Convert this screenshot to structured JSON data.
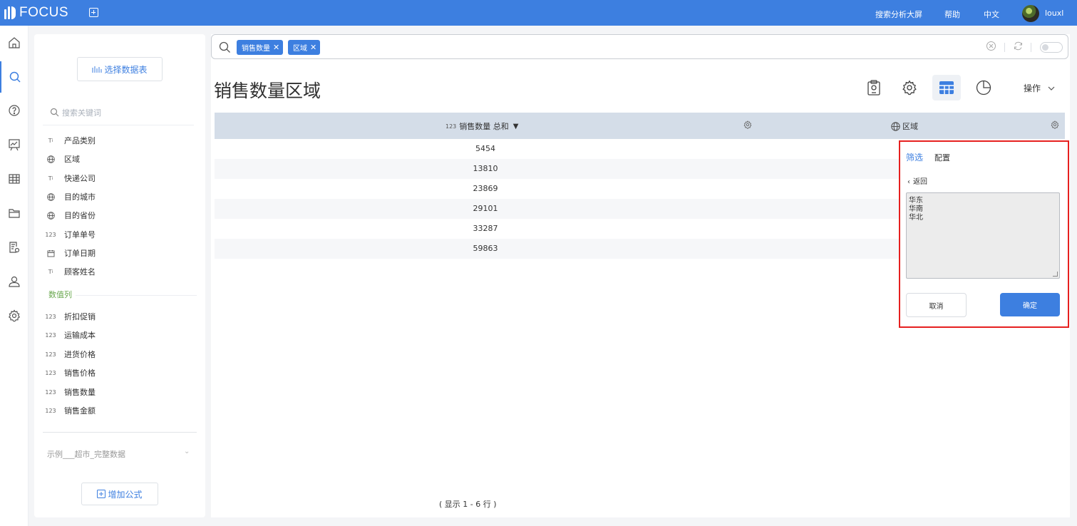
{
  "topbar": {
    "logo_text": "FOCUS",
    "links": {
      "dashboard": "搜索分析大屏",
      "help": "帮助",
      "language": "中文"
    },
    "username": "louxl"
  },
  "colors": {
    "brand": "#3d7fe0",
    "highlight_border": "#e6201f",
    "numeric_label": "#6aa84f"
  },
  "leftnav": [
    "home-icon",
    "search-icon",
    "help-icon",
    "chart-board-icon",
    "table-icon",
    "folder-icon",
    "report-settings-icon",
    "user-icon",
    "settings-icon"
  ],
  "sidebar": {
    "select_table_label": "选择数据表",
    "search_placeholder": "搜索关键词",
    "attribute_columns": [
      {
        "type": "text",
        "label": "产品类别"
      },
      {
        "type": "geo",
        "label": "区域"
      },
      {
        "type": "text",
        "label": "快递公司"
      },
      {
        "type": "geo",
        "label": "目的城市"
      },
      {
        "type": "geo",
        "label": "目的省份"
      },
      {
        "type": "number",
        "label": "订单单号"
      },
      {
        "type": "date",
        "label": "订单日期"
      },
      {
        "type": "text",
        "label": "顾客姓名"
      }
    ],
    "numeric_section_label": "数值列",
    "numeric_columns": [
      {
        "type": "number",
        "label": "折扣促销"
      },
      {
        "type": "number",
        "label": "运输成本"
      },
      {
        "type": "number",
        "label": "进货价格"
      },
      {
        "type": "number",
        "label": "销售价格"
      },
      {
        "type": "number",
        "label": "销售数量"
      },
      {
        "type": "number",
        "label": "销售金额"
      }
    ],
    "number_tag": "123",
    "example_source": "示例___超市_完整数据",
    "add_formula_label": "增加公式"
  },
  "search": {
    "tokens": [
      "销售数量",
      "区域"
    ]
  },
  "page_title": "销售数量区域",
  "toolbar": {
    "ops_label": "操作"
  },
  "table": {
    "columns": [
      {
        "tag": "123",
        "label": "销售数量 总和"
      },
      {
        "label": "区域"
      }
    ],
    "rows": [
      "5454",
      "13810",
      "23869",
      "29101",
      "33287",
      "59863"
    ],
    "footer": "( 显示 1 - 6 行 )"
  },
  "filter_panel": {
    "tab_filter": "筛选",
    "tab_config": "配置",
    "back_label": "返回",
    "values": [
      "华东",
      "华南",
      "华北"
    ],
    "cancel_label": "取消",
    "confirm_label": "确定"
  }
}
